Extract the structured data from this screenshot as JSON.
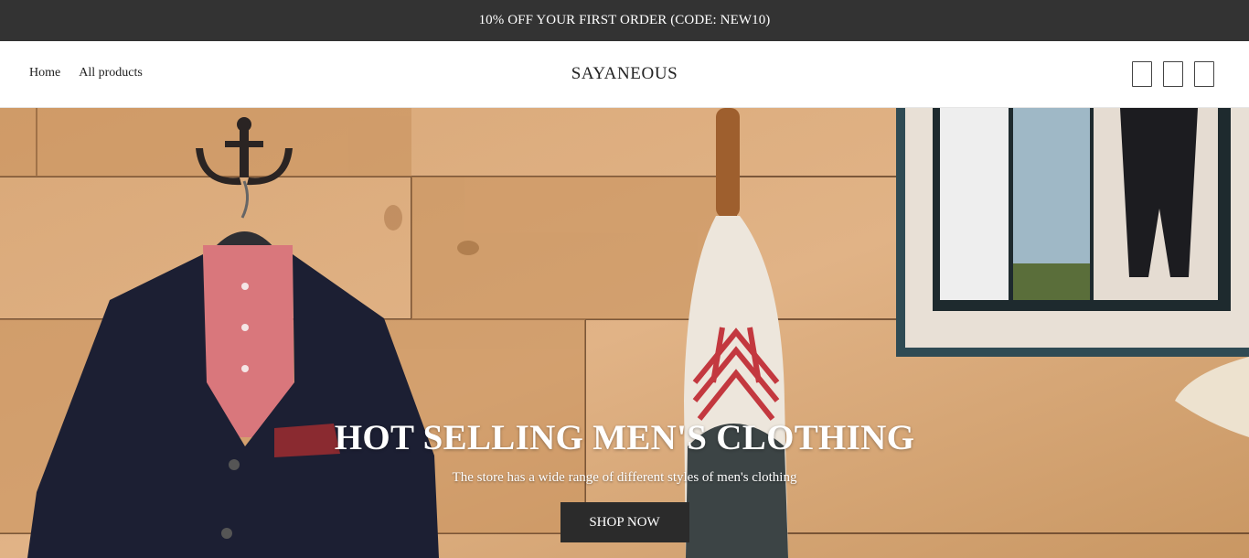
{
  "announcement": {
    "text": "10% OFF YOUR FIRST ORDER (CODE: NEW10)"
  },
  "header": {
    "nav": [
      {
        "label": "Home"
      },
      {
        "label": "All products"
      }
    ],
    "logo": "SAYANEOUS",
    "icons": [
      {
        "name": "search-icon"
      },
      {
        "name": "account-icon"
      },
      {
        "name": "cart-icon"
      }
    ]
  },
  "hero": {
    "title": "HOT SELLING MEN'S CLOTHING",
    "subtitle": "The store has a wide range of different styles of men's clothing",
    "button_label": "SHOP NOW"
  },
  "colors": {
    "announcement_bg": "#333333",
    "button_bg": "#2b2b2b",
    "wood": "#d8a574"
  }
}
